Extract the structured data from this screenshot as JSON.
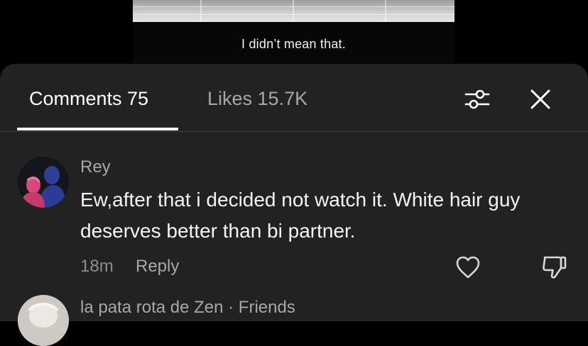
{
  "video": {
    "subtitle": "I didn’t mean that."
  },
  "sheet": {
    "tabs": [
      {
        "label": "Comments 75",
        "active": true
      },
      {
        "label": "Likes 15.7K",
        "active": false
      }
    ],
    "icons": {
      "filter": "sliders-icon",
      "close": "close-icon"
    }
  },
  "comments": [
    {
      "username": "Rey",
      "text": "Ew,after that i decided not watch it. White hair guy deserves better than bi partner.",
      "time": "18m",
      "reply_label": "Reply"
    },
    {
      "username": "la pata rota de Zen · Friends"
    }
  ],
  "colors": {
    "sheet_bg": "#222222",
    "secondary_text": "#a8a8a8",
    "primary_text": "#ffffff"
  }
}
